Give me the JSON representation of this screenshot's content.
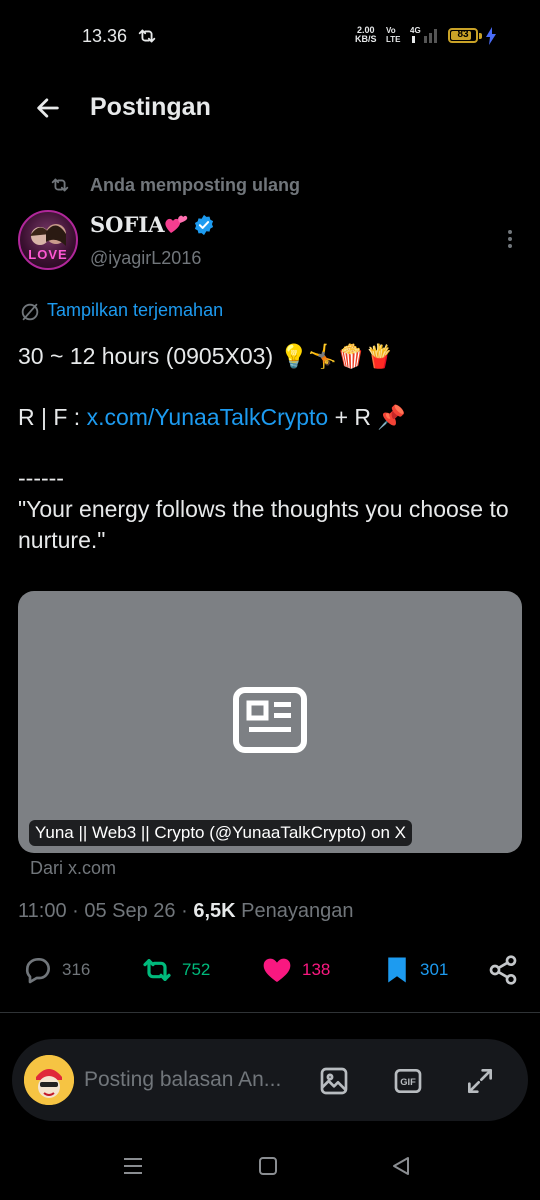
{
  "status_bar": {
    "time": "13.36",
    "speed_value": "2.00",
    "speed_unit": "KB/S",
    "volte_top": "Vo",
    "volte_bottom": "LTE",
    "network": "4G",
    "battery": "83",
    "battery_level": 0.83
  },
  "header": {
    "title": "Postingan"
  },
  "repost": {
    "label": "Anda memposting ulang"
  },
  "author": {
    "name": "SOFIA",
    "handle": "@iyagirL2016",
    "avatar_text": "LOVE"
  },
  "translate": {
    "label": "Tampilkan terjemahan"
  },
  "tweet": {
    "line1": "30 ~ 12 hours (0905X03) 💡🤸🍿🍟",
    "rf_prefix": "R | F : ",
    "rf_link": "x.com/YunaaTalkCrypto",
    "rf_suffix": " + R 📌",
    "dashes": "------",
    "quote": "\"Your energy follows the thoughts you choose to nurture.\""
  },
  "card": {
    "title": "Yuna || Web3 || Crypto (@YunaaTalkCrypto) on X",
    "source": "Dari x.com",
    "icon": "article-icon"
  },
  "meta": {
    "time": "11:00",
    "date": "05 Sep 26",
    "views_count": "6,5K",
    "views_label": "Penayangan"
  },
  "actions": {
    "replies": "316",
    "reposts": "752",
    "likes": "138",
    "bookmarks": "301"
  },
  "reply": {
    "placeholder": "Posting balasan An..."
  },
  "colors": {
    "accent": "#1d9bf0",
    "repost": "#00ba7c",
    "like": "#f91880",
    "muted": "#71767b",
    "battery": "#c9a227"
  }
}
